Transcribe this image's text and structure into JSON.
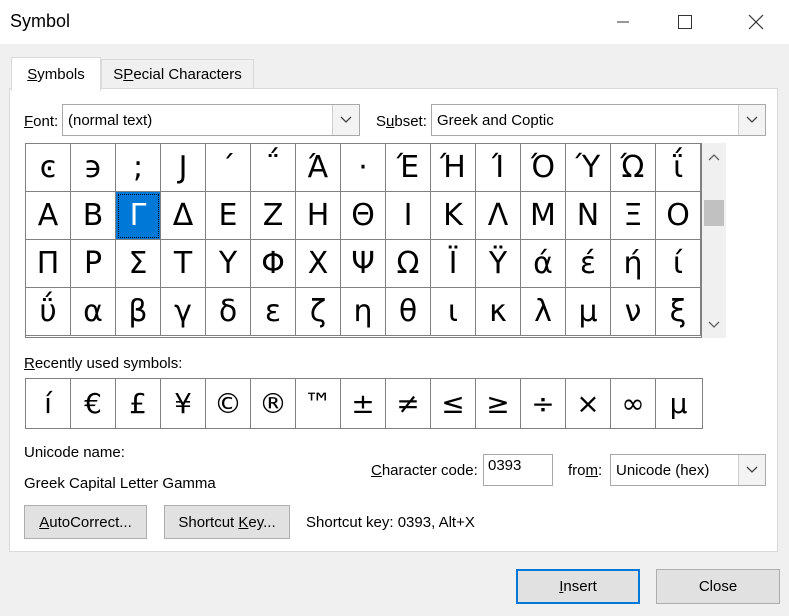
{
  "window": {
    "title": "Symbol",
    "minimize_glyph": "—",
    "maximize_glyph": "☐",
    "close_glyph": "✕"
  },
  "tabs": [
    {
      "label": "Symbols",
      "mnemonic": "S",
      "rest": "ymbols",
      "active": true
    },
    {
      "label": "Special Characters",
      "mnemonic": "P",
      "pre": "S",
      "rest": "ecial Characters",
      "active": false
    }
  ],
  "font": {
    "label_mnemonic": "F",
    "label_rest": "ont:",
    "value": "(normal text)"
  },
  "subset": {
    "label_pre": "S",
    "label_mnemonic": "u",
    "label_rest": "bset:",
    "value": "Greek and Coptic"
  },
  "symbol_grid": {
    "selected_index": 17,
    "rows": [
      [
        "ͼ",
        "϶",
        ";",
        "J",
        "΄",
        "΅",
        "Ά",
        "·",
        "Έ",
        "Ή",
        "Ί",
        "Ό",
        "Ύ",
        "Ώ",
        "ΐ"
      ],
      [
        "Α",
        "Β",
        "Γ",
        "Δ",
        "Ε",
        "Ζ",
        "Η",
        "Θ",
        "Ι",
        "Κ",
        "Λ",
        "Μ",
        "Ν",
        "Ξ",
        "Ο"
      ],
      [
        "Π",
        "Ρ",
        "Σ",
        "Τ",
        "Υ",
        "Φ",
        "Χ",
        "Ψ",
        "Ω",
        "Ϊ",
        "Ϋ",
        "ά",
        "έ",
        "ή",
        "ί"
      ],
      [
        "ΰ",
        "α",
        "β",
        "γ",
        "δ",
        "ε",
        "ζ",
        "η",
        "θ",
        "ι",
        "κ",
        "λ",
        "μ",
        "ν",
        "ξ"
      ]
    ]
  },
  "scrollbar": {
    "up_glyph": "⌃",
    "down_glyph": "⌄"
  },
  "recent": {
    "label_mnemonic": "R",
    "label_rest": "ecently used symbols:",
    "symbols": [
      "í",
      "€",
      "£",
      "¥",
      "©",
      "®",
      "™",
      "±",
      "≠",
      "≤",
      "≥",
      "÷",
      "×",
      "∞",
      "μ"
    ]
  },
  "unicode_name": {
    "label": "Unicode name:",
    "value": "Greek Capital Letter Gamma"
  },
  "char_code": {
    "label_mnemonic": "C",
    "label_rest": "haracter code:",
    "value": "0393"
  },
  "from": {
    "label_pre": "fro",
    "label_mnemonic": "m",
    "label_rest": ":",
    "value": "Unicode (hex)"
  },
  "buttons": {
    "autocorrect_mnemonic": "A",
    "autocorrect_rest": "utoCorrect...",
    "shortcut_pre": "Shortcut ",
    "shortcut_mnemonic": "K",
    "shortcut_rest": "ey...",
    "insert_mnemonic": "I",
    "insert_rest": "nsert",
    "close": "Close"
  },
  "shortcut_key_text": "Shortcut key: 0393, Alt+X",
  "colors": {
    "selection": "#0078d7",
    "primary_border": "#0078d7"
  }
}
